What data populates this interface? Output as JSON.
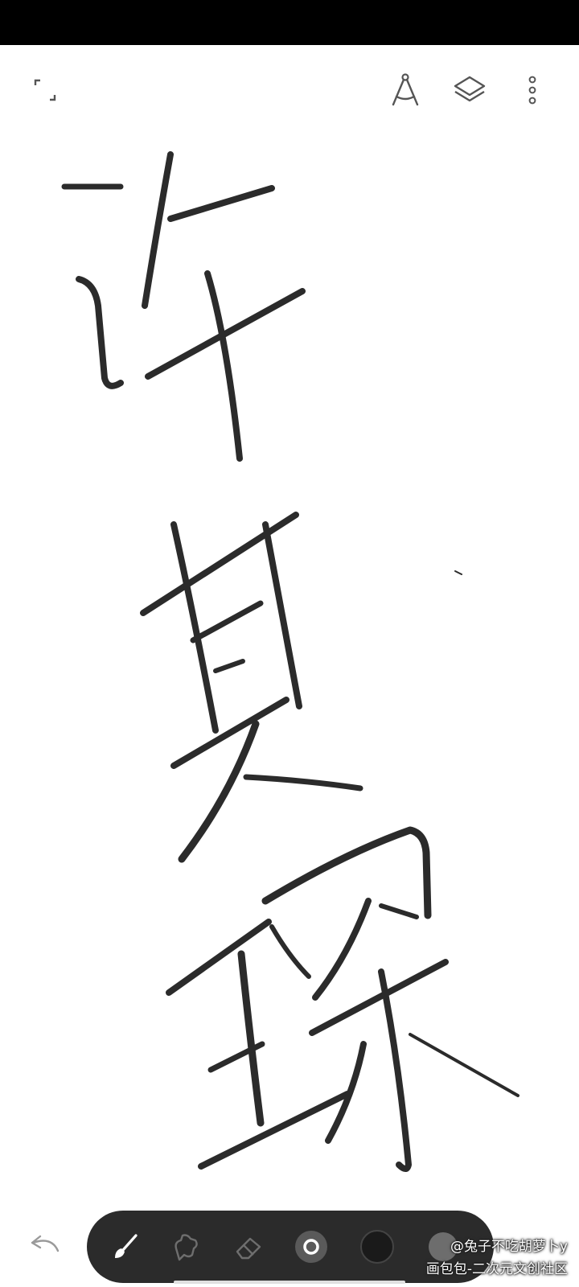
{
  "app": {
    "mode": "drawing-canvas"
  },
  "header": {
    "icons": [
      "fullscreen-icon",
      "ruler-icon",
      "layers-icon",
      "more-vertical-icon"
    ]
  },
  "canvas": {
    "drawn_text": "许某琛",
    "stroke_color": "#2b2b2b",
    "background": "#ffffff"
  },
  "toolbar": {
    "background": "#2b2b2b",
    "tools": [
      "brush-icon",
      "smudge-icon",
      "eraser-icon",
      "brush-size-icon",
      "color-swatch",
      "opacity-icon"
    ],
    "selected_tool": "brush-icon",
    "current_color": "#1a1a1a"
  },
  "watermark": {
    "line1": "@兔子不吃胡萝卜y",
    "line2": "画包包-二次元文创社区"
  }
}
